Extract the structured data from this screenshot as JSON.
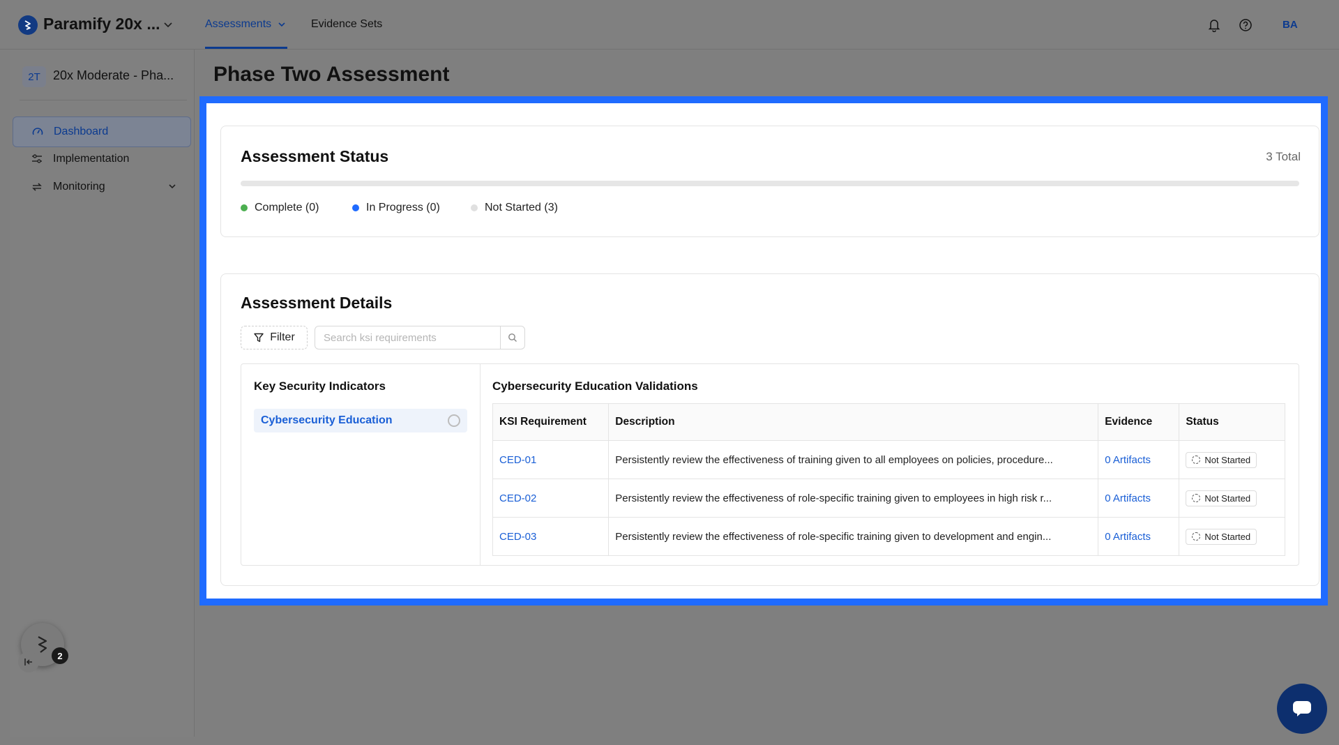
{
  "topbar": {
    "brand": "Paramify 20x ...",
    "nav": [
      {
        "label": "Assessments"
      },
      {
        "label": "Evidence Sets"
      }
    ],
    "avatar": "BA"
  },
  "sidebar": {
    "project_badge": "2T",
    "project_name": "20x Moderate - Pha...",
    "items": [
      {
        "label": "Dashboard",
        "icon": "gauge-icon",
        "active": true
      },
      {
        "label": "Implementation",
        "icon": "sliders-icon"
      },
      {
        "label": "Monitoring",
        "icon": "sync-icon",
        "expandable": true
      }
    ],
    "helper_badge": "2"
  },
  "main": {
    "page_title": "Phase Two Assessment",
    "status": {
      "title": "Assessment Status",
      "total": "3 Total",
      "progress_fraction": 0,
      "legend": [
        {
          "label": "Complete (0)",
          "color": "#4caf50"
        },
        {
          "label": "In Progress (0)",
          "color": "#1f6bff"
        },
        {
          "label": "Not Started (3)",
          "color": "#e0e0e0"
        }
      ]
    },
    "details": {
      "title": "Assessment Details",
      "filter_label": "Filter",
      "search_placeholder": "Search ksi requirements",
      "ksi_heading": "Key Security Indicators",
      "ksi_items": [
        {
          "label": "Cybersecurity Education"
        }
      ],
      "table_title": "Cybersecurity Education Validations",
      "columns": [
        "KSI Requirement",
        "Description",
        "Evidence",
        "Status"
      ],
      "rows": [
        {
          "id": "CED-01",
          "description": "Persistently review the effectiveness of training given to all employees on policies, procedure...",
          "evidence": "0 Artifacts",
          "status": "Not Started"
        },
        {
          "id": "CED-02",
          "description": "Persistently review the effectiveness of role-specific training given to employees in high risk r...",
          "evidence": "0 Artifacts",
          "status": "Not Started"
        },
        {
          "id": "CED-03",
          "description": "Persistently review the effectiveness of role-specific training given to development and engin...",
          "evidence": "0 Artifacts",
          "status": "Not Started"
        }
      ]
    }
  },
  "colors": {
    "accent": "#1f6bff",
    "link": "#1a5fd6",
    "highlight_border": "#1f6bff",
    "chat_button": "#0d2f6e"
  }
}
